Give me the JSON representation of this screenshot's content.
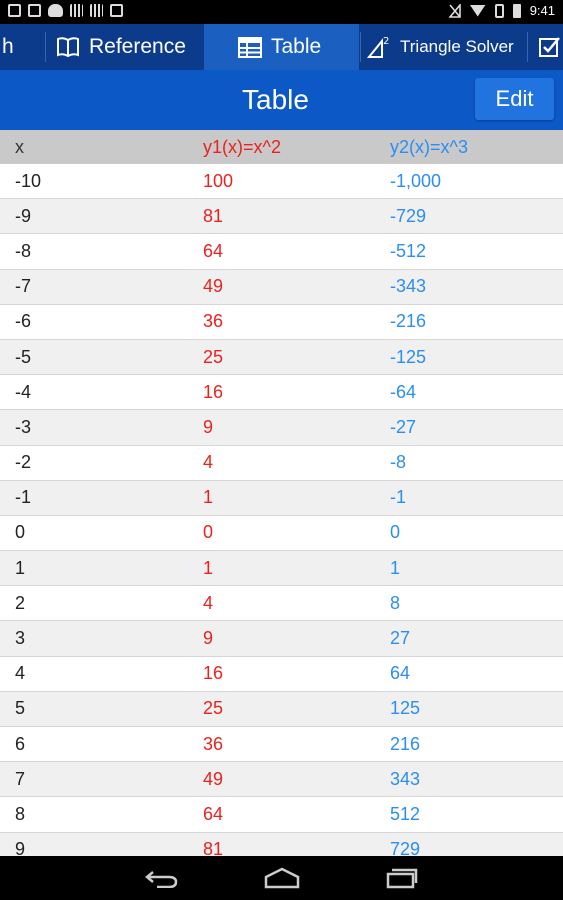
{
  "status_bar": {
    "time": "9:41",
    "left_icons": [
      "notification-icon",
      "image-icon",
      "cloud-icon",
      "barcode-icon",
      "barcode-icon",
      "briefcase-icon"
    ],
    "right_icons": [
      "signal-off-icon",
      "wifi-icon",
      "bluetooth-icon",
      "battery-icon"
    ]
  },
  "tabs": [
    {
      "label": "h",
      "icon": "none"
    },
    {
      "label": "Reference",
      "icon": "book-icon"
    },
    {
      "label": "Table",
      "icon": "table-icon",
      "active": true
    },
    {
      "label": "Triangle Solver",
      "icon": "triangle-icon"
    },
    {
      "label": "",
      "icon": "checkbox-icon"
    }
  ],
  "header": {
    "title": "Table",
    "edit_label": "Edit"
  },
  "table": {
    "columns": [
      "x",
      "y1(x)=x^2",
      "y2(x)=x^3"
    ],
    "rows": [
      [
        "-10",
        "100",
        "-1,000"
      ],
      [
        "-9",
        "81",
        "-729"
      ],
      [
        "-8",
        "64",
        "-512"
      ],
      [
        "-7",
        "49",
        "-343"
      ],
      [
        "-6",
        "36",
        "-216"
      ],
      [
        "-5",
        "25",
        "-125"
      ],
      [
        "-4",
        "16",
        "-64"
      ],
      [
        "-3",
        "9",
        "-27"
      ],
      [
        "-2",
        "4",
        "-8"
      ],
      [
        "-1",
        "1",
        "-1"
      ],
      [
        "0",
        "0",
        "0"
      ],
      [
        "1",
        "1",
        "1"
      ],
      [
        "2",
        "4",
        "8"
      ],
      [
        "3",
        "9",
        "27"
      ],
      [
        "4",
        "16",
        "64"
      ],
      [
        "5",
        "25",
        "125"
      ],
      [
        "6",
        "36",
        "216"
      ],
      [
        "7",
        "49",
        "343"
      ],
      [
        "8",
        "64",
        "512"
      ],
      [
        "9",
        "81",
        "729"
      ]
    ]
  },
  "colors": {
    "tab_strip": "#0d3b8c",
    "title_bar": "#0c58c6",
    "y1_color": "#e8231f",
    "y2_color": "#2b8ef2"
  },
  "nav_bar": {
    "buttons": [
      "back-icon",
      "home-icon",
      "recents-icon"
    ]
  }
}
